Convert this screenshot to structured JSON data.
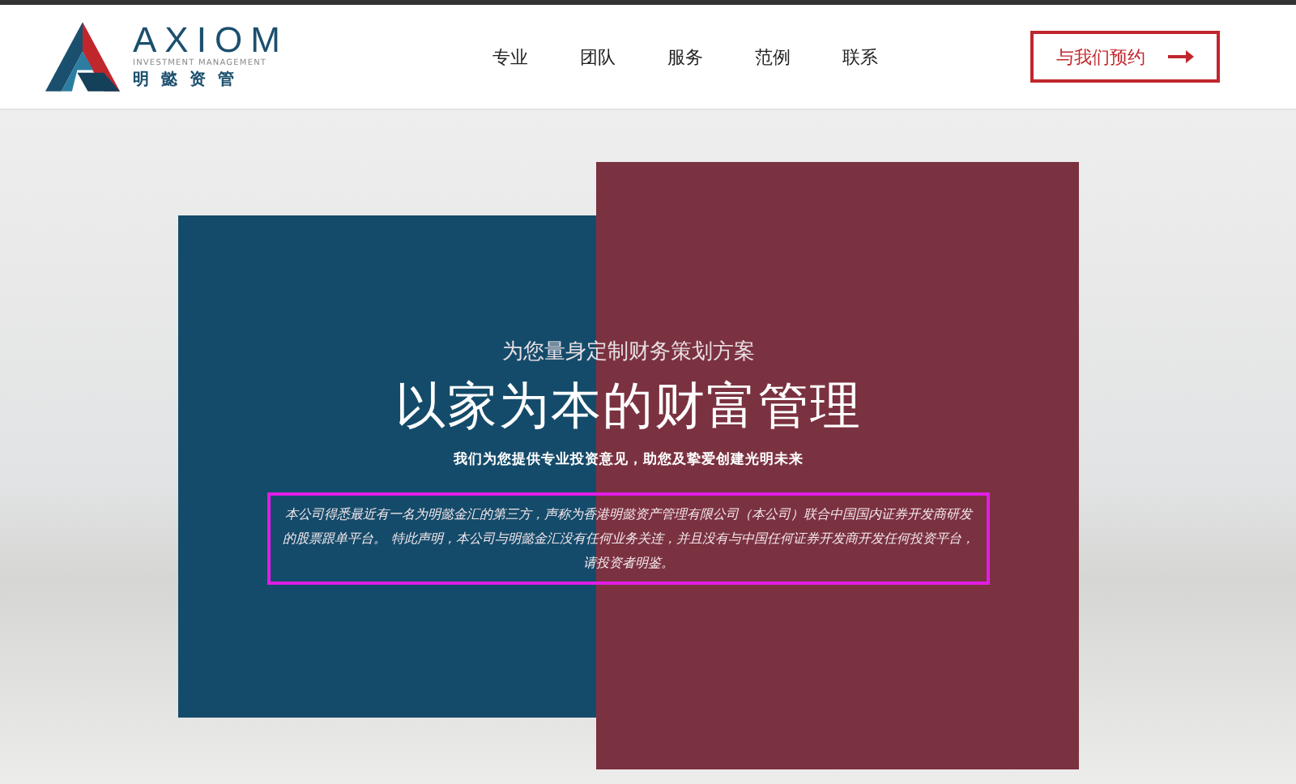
{
  "header": {
    "logo": {
      "name": "AXIOM",
      "tagline": "INVESTMENT MANAGEMENT",
      "chinese_name": "明 懿 资 管"
    },
    "nav": [
      {
        "label": "专业"
      },
      {
        "label": "团队"
      },
      {
        "label": "服务"
      },
      {
        "label": "范例"
      },
      {
        "label": "联系"
      }
    ],
    "cta_button": {
      "label": "与我们预约"
    }
  },
  "hero": {
    "subtitle": "为您量身定制财务策划方案",
    "title": "以家为本的财富管理",
    "tagline": "我们为您提供专业投资意见，助您及挚爱创建光明未来",
    "notice": "本公司得悉最近有一名为明懿金汇的第三方，声称为香港明懿资产管理有限公司（本公司）联合中国国内证券开发商研发的股票跟单平台。 特此声明，本公司与明懿金汇没有任何业务关连，并且没有与中国任何证券开发商开发任何投资平台，请投资者明鉴。"
  }
}
